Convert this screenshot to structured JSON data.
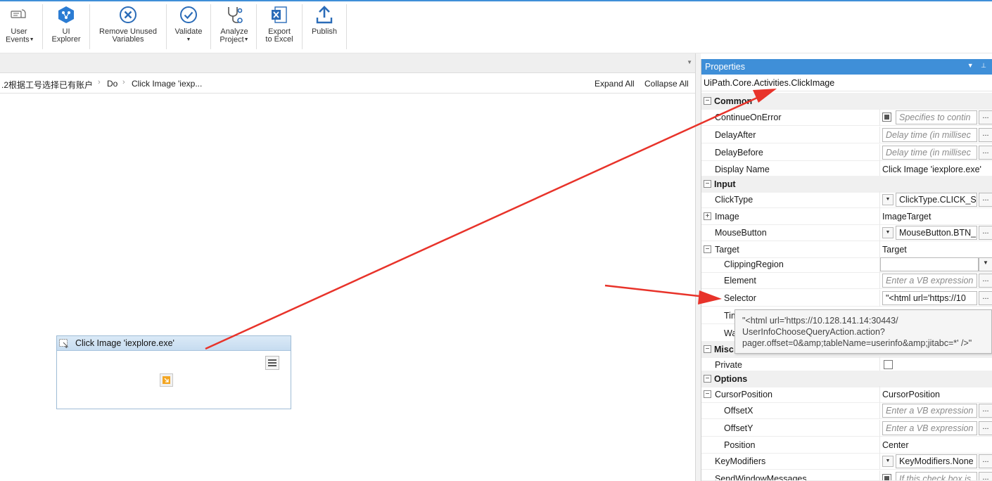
{
  "ribbon": {
    "user_events": [
      "User",
      "Events"
    ],
    "ui_explorer": [
      "UI",
      "Explorer"
    ],
    "remove_unused": [
      "Remove Unused",
      "Variables"
    ],
    "validate": "Validate",
    "analyze": [
      "Analyze",
      "Project"
    ],
    "export": [
      "Export",
      "to Excel"
    ],
    "publish": "Publish"
  },
  "breadcrumb": {
    "items": [
      ".2根据工号选择已有账户",
      "Do",
      "Click Image 'iexp..."
    ],
    "expand_all": "Expand All",
    "collapse_all": "Collapse All"
  },
  "activity": {
    "title": "Click Image 'iexplore.exe'"
  },
  "properties": {
    "header": "Properties",
    "type_name": "UiPath.Core.Activities.ClickImage",
    "categories": {
      "common": "Common",
      "input": "Input",
      "misc": "Misc",
      "options": "Options"
    },
    "rows": {
      "continue_on_error": {
        "name": "ContinueOnError",
        "placeholder": "Specifies to contin"
      },
      "delay_after": {
        "name": "DelayAfter",
        "placeholder": "Delay time (in millisec"
      },
      "delay_before": {
        "name": "DelayBefore",
        "placeholder": "Delay time (in millisec"
      },
      "display_name": {
        "name": "Display Name",
        "value": "Click Image 'iexplore.exe'"
      },
      "click_type": {
        "name": "ClickType",
        "value": "ClickType.CLICK_SI"
      },
      "image": {
        "name": "Image",
        "value": "ImageTarget"
      },
      "mouse_button": {
        "name": "MouseButton",
        "value": "MouseButton.BTN_"
      },
      "target": {
        "name": "Target",
        "value": "Target"
      },
      "clipping_region": {
        "name": "ClippingRegion",
        "value": ""
      },
      "element": {
        "name": "Element",
        "placeholder": "Enter a VB expression"
      },
      "selector": {
        "name": "Selector",
        "value": "\"<html url='https://10"
      },
      "timeout": {
        "name": "Tim"
      },
      "wait": {
        "name": "Wa"
      },
      "private": {
        "name": "Private"
      },
      "cursor_position": {
        "name": "CursorPosition",
        "value": "CursorPosition"
      },
      "offset_x": {
        "name": "OffsetX",
        "placeholder": "Enter a VB expression"
      },
      "offset_y": {
        "name": "OffsetY",
        "placeholder": "Enter a VB expression"
      },
      "position": {
        "name": "Position",
        "value": "Center"
      },
      "key_modifiers": {
        "name": "KeyModifiers",
        "value": "KeyModifiers.None"
      },
      "send_window_messages": {
        "name": "SendWindowMessages",
        "placeholder": "If this check box is"
      }
    }
  },
  "tooltip": {
    "line1": "\"<html url='https://10.128.141.14:30443/",
    "line2": "UserInfoChooseQueryAction.action?",
    "line3": "pager.offset=0&amp;tableName=userinfo&amp;jitabc=*' />\""
  },
  "colors": {
    "accent": "#3f8fd8",
    "annotation_arrow": "#e8332a"
  }
}
